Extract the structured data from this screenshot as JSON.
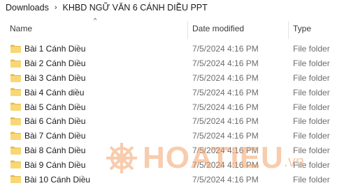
{
  "breadcrumb": {
    "items": [
      "Downloads",
      "KHBD NGỮ VĂN 6 CÁNH DIỀU PPT"
    ],
    "separator": "›"
  },
  "columns": {
    "name": "Name",
    "date": "Date modified",
    "type": "Type",
    "sort_indicator": "^"
  },
  "rows": [
    {
      "name": "Bài 1 Cánh Diều",
      "date": "7/5/2024 4:16 PM",
      "type": "File folder",
      "icon": "folder-icon"
    },
    {
      "name": "Bài 2 Cánh Diều",
      "date": "7/5/2024 4:16 PM",
      "type": "File folder",
      "icon": "folder-icon"
    },
    {
      "name": "Bài 3 Cánh Diều",
      "date": "7/5/2024 4:16 PM",
      "type": "File folder",
      "icon": "folder-icon"
    },
    {
      "name": "Bài 4 Cánh diều",
      "date": "7/5/2024 4:16 PM",
      "type": "File folder",
      "icon": "folder-icon"
    },
    {
      "name": "Bài 5 Cánh Diều",
      "date": "7/5/2024 4:16 PM",
      "type": "File folder",
      "icon": "folder-icon"
    },
    {
      "name": "Bài 6 Cánh Diều",
      "date": "7/5/2024 4:16 PM",
      "type": "File folder",
      "icon": "folder-icon"
    },
    {
      "name": "Bài 7 Cánh Diều",
      "date": "7/5/2024 4:16 PM",
      "type": "File folder",
      "icon": "folder-icon"
    },
    {
      "name": "Bài 8 Cánh Diều",
      "date": "7/5/2024 4:16 PM",
      "type": "File folder",
      "icon": "folder-icon"
    },
    {
      "name": "Bài 9 Cánh Diều",
      "date": "7/5/2024 4:16 PM",
      "type": "File folder",
      "icon": "folder-icon"
    },
    {
      "name": "Bài 10 Cánh Diều",
      "date": "7/5/2024 4:16 PM",
      "type": "File folder",
      "icon": "folder-icon"
    }
  ],
  "watermark": {
    "text": "HOATIEU",
    "suffix": ".vn",
    "icon": "ship-wheel-icon",
    "color": "#f3a46a"
  },
  "colors": {
    "folder_body": "#f8d775",
    "folder_tab": "#e8b84a"
  }
}
